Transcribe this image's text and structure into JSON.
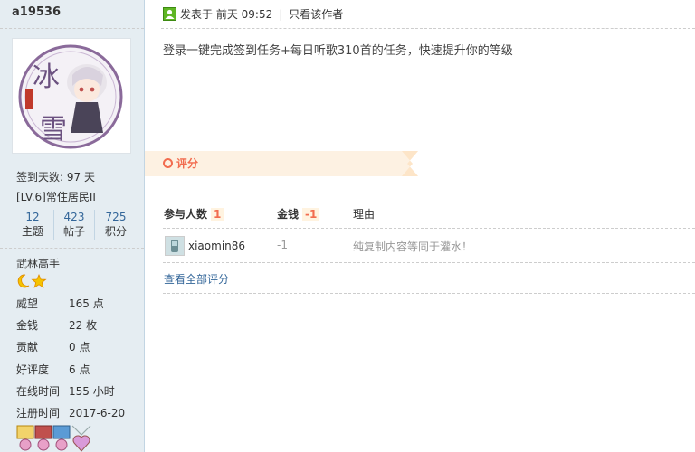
{
  "user": {
    "name": "a19536",
    "checkin": "签到天数: 97 天",
    "level": "[LV.6]常住居民II",
    "stats": [
      {
        "num": "12",
        "label": "主题"
      },
      {
        "num": "423",
        "label": "帖子"
      },
      {
        "num": "725",
        "label": "积分"
      }
    ],
    "title": "武林高手",
    "info": [
      {
        "key": "威望",
        "value": "165 点"
      },
      {
        "key": "金钱",
        "value": "22 枚"
      },
      {
        "key": "贡献",
        "value": "0 点"
      },
      {
        "key": "好评度",
        "value": "6 点"
      },
      {
        "key": "在线时间",
        "value": "155 小时"
      },
      {
        "key": "注册时间",
        "value": "2017-6-20"
      }
    ]
  },
  "post": {
    "posted_label": "发表于",
    "posted_time": "前天 09:52",
    "author_only": "只看该作者",
    "content": "登录一键完成签到任务+每日听歌310首的任务，快速提升你的等级"
  },
  "rating": {
    "title": "评分",
    "col_participants": "参与人数",
    "participants_count": "1",
    "col_money": "金钱",
    "money_total": "-1",
    "col_reason": "理由",
    "entries": [
      {
        "user": "xiaomin86",
        "value": "-1",
        "reason": "纯复制内容等同于灌水！"
      }
    ],
    "view_all": "查看全部评分"
  },
  "colors": {
    "sidebar_bg": "#e5edf2",
    "link": "#336699",
    "accent": "#f26c4f"
  }
}
